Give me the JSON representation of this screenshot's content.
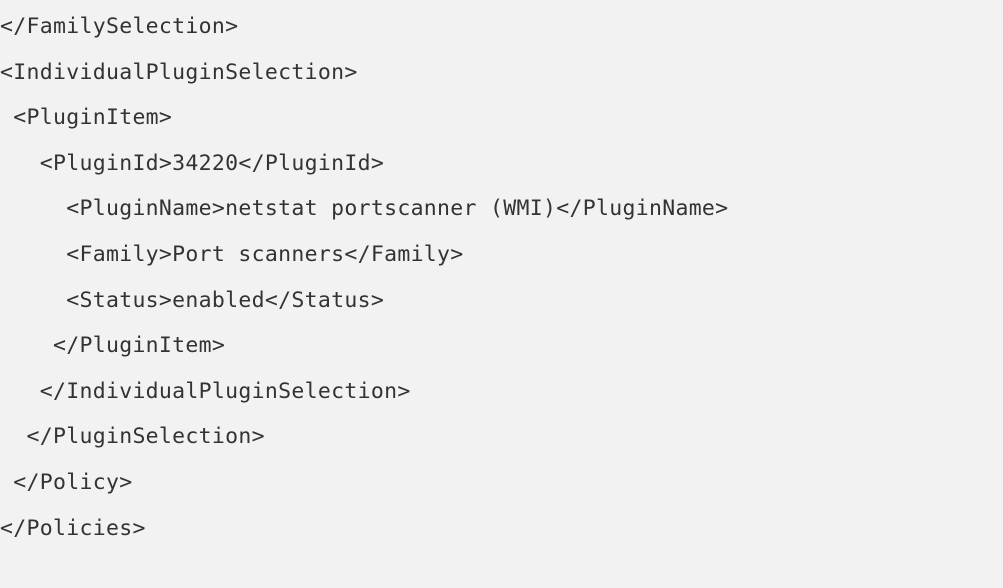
{
  "code_lines": [
    "</FamilySelection>",
    "<IndividualPluginSelection>",
    " <PluginItem>",
    "   <PluginId>34220</PluginId>",
    "     <PluginName>netstat portscanner (WMI)</PluginName>",
    "     <Family>Port scanners</Family>",
    "     <Status>enabled</Status>",
    "    </PluginItem>",
    "   </IndividualPluginSelection>",
    "  </PluginSelection>",
    " </Policy>",
    "</Policies>"
  ]
}
